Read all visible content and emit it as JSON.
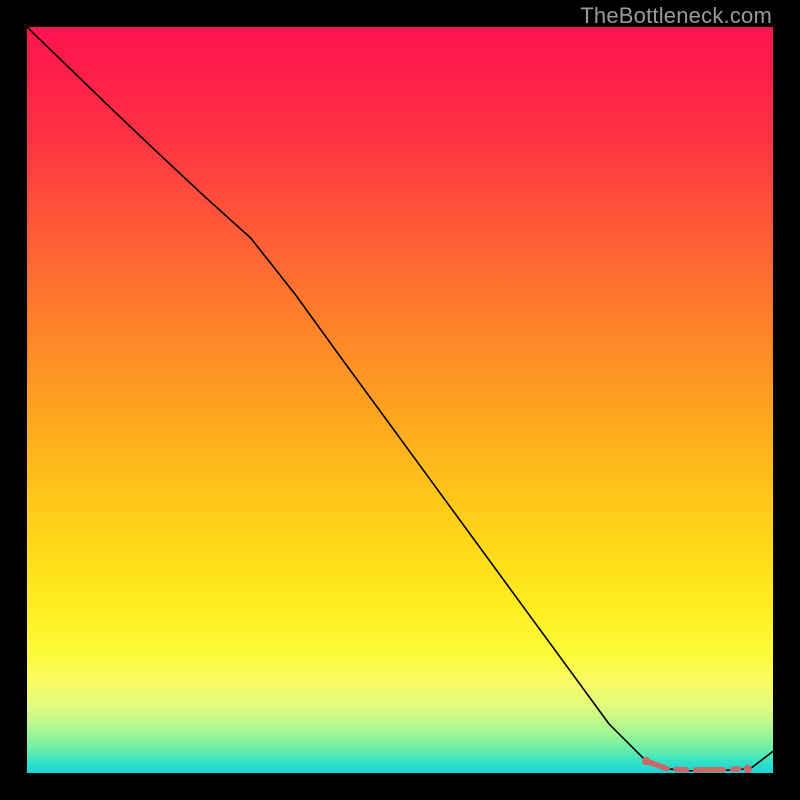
{
  "watermark": "TheBottleneck.com",
  "chart_data": {
    "type": "line",
    "title": "",
    "xlabel": "",
    "ylabel": "",
    "xlim": [
      0,
      100
    ],
    "ylim": [
      0,
      100
    ],
    "grid": false,
    "series": [
      {
        "name": "curve",
        "color": "#000000",
        "stroke_width": 1.6,
        "x": [
          0,
          6,
          12,
          18,
          24,
          30,
          36,
          42,
          48,
          54,
          60,
          66,
          72,
          78,
          83,
          86,
          88.5,
          91,
          93,
          95,
          97,
          100
        ],
        "y": [
          100,
          94.2,
          88.4,
          82.7,
          77.1,
          71.7,
          64.1,
          55.8,
          47.6,
          39.4,
          31.2,
          23.0,
          14.8,
          6.6,
          1.6,
          0.55,
          0.3,
          0.3,
          0.35,
          0.45,
          0.6,
          2.9
        ]
      }
    ],
    "highlight": {
      "color": "#c96a6a",
      "dot_radius": 4.2,
      "dash_pattern": [
        14,
        7,
        8,
        7,
        22,
        7,
        3
      ],
      "points_x": [
        83.0,
        96.6
      ],
      "points_y": [
        1.6,
        0.55
      ],
      "segments": [
        {
          "x0": 83.0,
          "y0": 1.6,
          "x1": 85.8,
          "y1": 0.58
        },
        {
          "x0": 87.0,
          "y0": 0.48,
          "x1": 88.4,
          "y1": 0.44
        },
        {
          "x0": 89.6,
          "y0": 0.42,
          "x1": 93.4,
          "y1": 0.46
        },
        {
          "x0": 94.6,
          "y0": 0.5,
          "x1": 95.4,
          "y1": 0.53
        }
      ]
    }
  }
}
